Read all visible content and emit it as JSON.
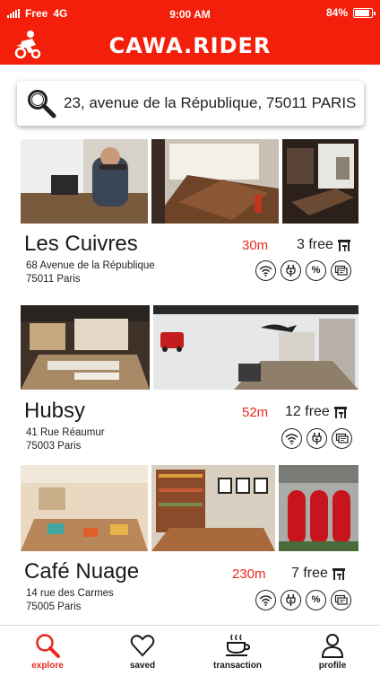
{
  "status_bar": {
    "carrier": "Free",
    "network": "4G",
    "time": "9:00 AM",
    "battery": "84%"
  },
  "app": {
    "title": "CAWA.RIDER",
    "accent": "#f41f0a"
  },
  "search": {
    "value": "23, avenue de la République, 75011 PARIS",
    "icon": "search-icon"
  },
  "cafes": [
    {
      "name": "Les Cuivres",
      "address_line1": "68 Avenue de la République",
      "address_line2": "75011 Paris",
      "distance": "30m",
      "free": "3 free",
      "amenities": [
        "wifi-icon",
        "plug-icon",
        "discount-icon",
        "screen-icon"
      ]
    },
    {
      "name": "Hubsy",
      "address_line1": "41 Rue Réaumur",
      "address_line2": "75003 Paris",
      "distance": "52m",
      "free": "12 free",
      "amenities": [
        "wifi-icon",
        "plug-icon",
        "screen-icon"
      ]
    },
    {
      "name": "Café Nuage",
      "address_line1": "14 rue des Carmes",
      "address_line2": "75005 Paris",
      "distance": "230m",
      "free": "7 free",
      "amenities": [
        "wifi-icon",
        "plug-icon",
        "discount-icon",
        "screen-icon"
      ]
    }
  ],
  "amenity_glyph": {
    "discount": "%"
  },
  "nav": [
    {
      "label": "explore",
      "icon": "search-icon",
      "active": true
    },
    {
      "label": "saved",
      "icon": "heart-icon",
      "active": false
    },
    {
      "label": "transaction",
      "icon": "coffee-cup-icon",
      "active": false
    },
    {
      "label": "profile",
      "icon": "user-icon",
      "active": false
    }
  ]
}
